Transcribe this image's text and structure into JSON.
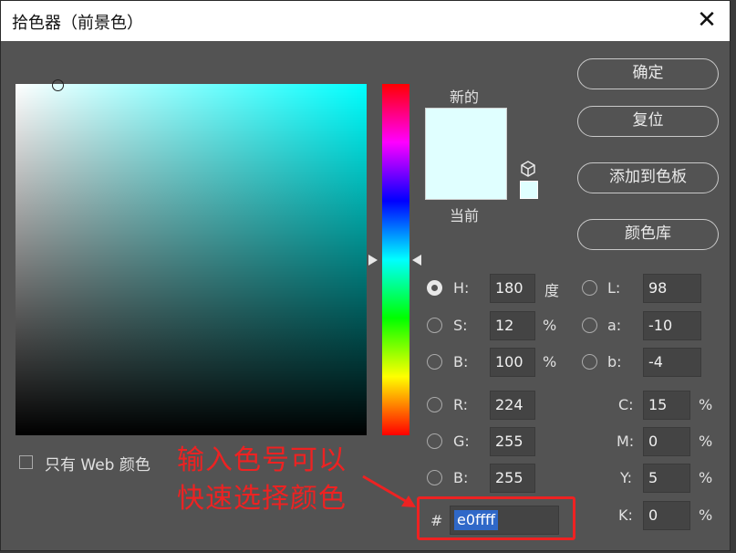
{
  "window": {
    "title": "拾色器（前景色）",
    "close_label": "✕"
  },
  "preview": {
    "new_label": "新的",
    "current_label": "当前",
    "new_color": "#e0ffff",
    "current_color": "#e0ffff"
  },
  "buttons": {
    "ok": "确定",
    "reset": "复位",
    "add_swatch": "添加到色板",
    "color_library": "颜色库"
  },
  "hsb": {
    "h": {
      "label": "H:",
      "value": "180",
      "unit": "度"
    },
    "s": {
      "label": "S:",
      "value": "12",
      "unit": "%"
    },
    "b": {
      "label": "B:",
      "value": "100",
      "unit": "%"
    }
  },
  "lab": {
    "l": {
      "label": "L:",
      "value": "98"
    },
    "a": {
      "label": "a:",
      "value": "-10"
    },
    "b": {
      "label": "b:",
      "value": "-4"
    }
  },
  "rgb": {
    "r": {
      "label": "R:",
      "value": "224"
    },
    "g": {
      "label": "G:",
      "value": "255"
    },
    "b": {
      "label": "B:",
      "value": "255"
    }
  },
  "cmyk": {
    "c": {
      "label": "C:",
      "value": "15",
      "unit": "%"
    },
    "m": {
      "label": "M:",
      "value": "0",
      "unit": "%"
    },
    "y": {
      "label": "Y:",
      "value": "5",
      "unit": "%"
    },
    "k": {
      "label": "K:",
      "value": "0",
      "unit": "%"
    }
  },
  "hex": {
    "label": "#",
    "value": "e0ffff"
  },
  "web_only": {
    "label": "只有 Web 颜色",
    "checked": false
  },
  "annotation": {
    "line1": "输入色号可以",
    "line2": "快速选择颜色",
    "color": "#ee2222"
  },
  "selected_mode": "H"
}
